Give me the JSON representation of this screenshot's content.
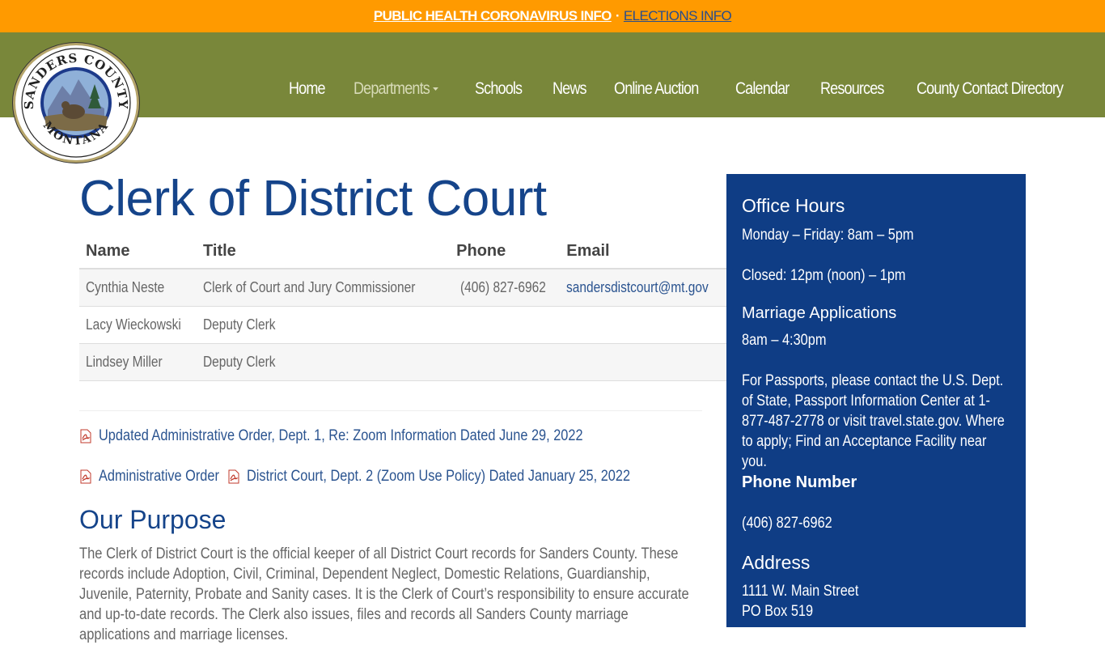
{
  "alert": {
    "link1": "PUBLIC HEALTH CORONAVIRUS INFO",
    "separator": "·",
    "link2": "ELECTIONS INFO"
  },
  "logo": {
    "top_text": "SANDERS COUNTY",
    "bottom_text": "MONTANA"
  },
  "nav": {
    "items": [
      "Home",
      "Departments",
      "Schools",
      "News",
      "Online Auction",
      "Calendar",
      "Resources",
      "County Contact Directory"
    ]
  },
  "page": {
    "title": "Clerk of District Court"
  },
  "table": {
    "headers": [
      "Name",
      "Title",
      "Phone",
      "Email"
    ],
    "rows": [
      {
        "name": "Cynthia Neste",
        "title": "Clerk of Court and Jury Commissioner",
        "phone": "(406) 827-6962",
        "email": "sandersdistcourt@mt.gov"
      },
      {
        "name": "Lacy Wieckowski",
        "title": "Deputy Clerk",
        "phone": "",
        "email": ""
      },
      {
        "name": "Lindsey Miller",
        "title": "Deputy Clerk",
        "phone": "",
        "email": ""
      }
    ]
  },
  "documents": {
    "doc1": "Updated Administrative Order, Dept. 1, Re: Zoom Information Dated June 29, 2022",
    "doc2a": "Administrative Order",
    "doc2b": "District Court, Dept. 2 (Zoom Use Policy) Dated January 25, 2022"
  },
  "purpose": {
    "heading": "Our Purpose",
    "text": "The Clerk of District Court is the official keeper of all District Court records for Sanders County. These records include Adoption, Civil, Criminal, Dependent Neglect, Domestic Relations, Guardianship, Juvenile, Paternity, Probate and Sanity cases. It is the Clerk of Court’s responsibility to ensure accurate and up-to-date records. The Clerk also issues, files and records all Sanders County marriage applications and marriage licenses."
  },
  "sidebar": {
    "office_hours_heading": "Office Hours",
    "hours_line": "Monday – Friday: 8am – 5pm",
    "closed_line": "Closed: 12pm (noon) – 1pm",
    "marriage_heading": "Marriage Applications",
    "marriage_hours": "8am – 4:30pm",
    "passport_text": "For Passports, please contact the U.S. Dept. of State, Passport Information Center at 1-877-487-2778 or visit travel.state.gov. Where to apply; Find an Acceptance Facility near you.",
    "phone_heading": "Phone Number",
    "phone": "(406) 827-6962",
    "address_heading": "Address",
    "address_line1": "1111 W. Main Street",
    "address_line2": "PO Box 519"
  },
  "colors": {
    "alert_bg": "#ff9a00",
    "nav_bg": "#79873a",
    "heading_blue": "#15448a",
    "sidebar_bg": "#0f3d85",
    "link_blue": "#2b5490"
  }
}
